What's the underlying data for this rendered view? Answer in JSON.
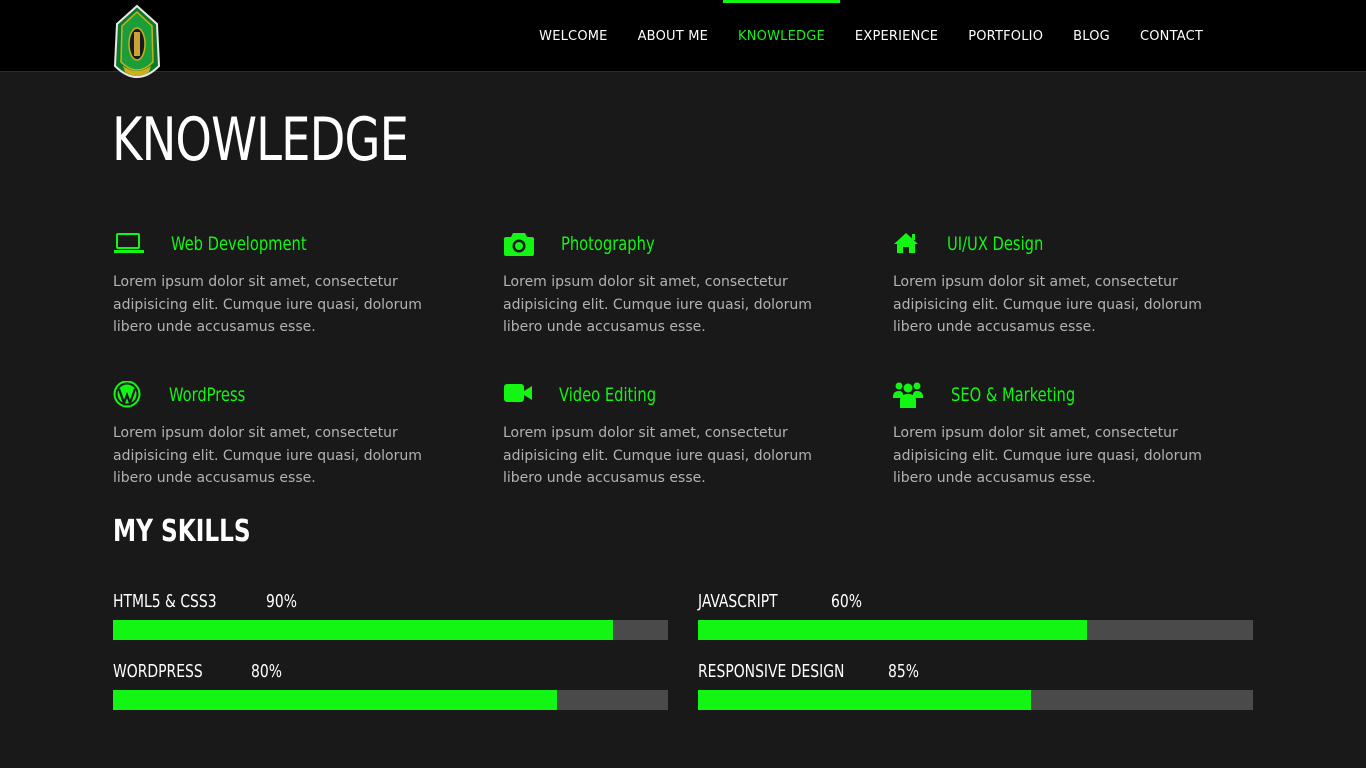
{
  "colors": {
    "accent": "#13f513",
    "background": "#191919",
    "header": "#000000",
    "bar_track": "#4a4a4a"
  },
  "nav": {
    "items": [
      {
        "label": "WELCOME"
      },
      {
        "label": "ABOUT ME"
      },
      {
        "label": "KNOWLEDGE",
        "active": true
      },
      {
        "label": "EXPERIENCE"
      },
      {
        "label": "PORTFOLIO"
      },
      {
        "label": "BLOG"
      },
      {
        "label": "CONTACT"
      }
    ]
  },
  "page": {
    "title": "KNOWLEDGE"
  },
  "services": [
    {
      "icon": "laptop-icon",
      "title": "Web Development",
      "text": "Lorem ipsum dolor sit amet, consectetur adipisicing elit. Cumque iure quasi, dolorum libero unde accusamus esse."
    },
    {
      "icon": "camera-icon",
      "title": "Photography",
      "text": "Lorem ipsum dolor sit amet, consectetur adipisicing elit. Cumque iure quasi, dolorum libero unde accusamus esse."
    },
    {
      "icon": "home-icon",
      "title": "UI/UX Design",
      "text": "Lorem ipsum dolor sit amet, consectetur adipisicing elit. Cumque iure quasi, dolorum libero unde accusamus esse."
    },
    {
      "icon": "wordpress-icon",
      "title": "WordPress",
      "text": "Lorem ipsum dolor sit amet, consectetur adipisicing elit. Cumque iure quasi, dolorum libero unde accusamus esse."
    },
    {
      "icon": "video-camera-icon",
      "title": "Video Editing",
      "text": "Lorem ipsum dolor sit amet, consectetur adipisicing elit. Cumque iure quasi, dolorum libero unde accusamus esse."
    },
    {
      "icon": "users-icon",
      "title": "SEO & Marketing",
      "text": "Lorem ipsum dolor sit amet, consectetur adipisicing elit. Cumque iure quasi, dolorum libero unde accusamus esse."
    }
  ],
  "skills": {
    "title": "MY SKILLS",
    "items": [
      {
        "name": "HTML5 & CSS3",
        "percent_label": "90%",
        "bar_fill_fraction": 0.9
      },
      {
        "name": "JAVASCRIPT",
        "percent_label": "60%",
        "bar_fill_fraction": 0.7
      },
      {
        "name": "WORDPRESS",
        "percent_label": "80%",
        "bar_fill_fraction": 0.8
      },
      {
        "name": "RESPONSIVE DESIGN",
        "percent_label": "85%",
        "bar_fill_fraction": 0.6
      }
    ]
  }
}
